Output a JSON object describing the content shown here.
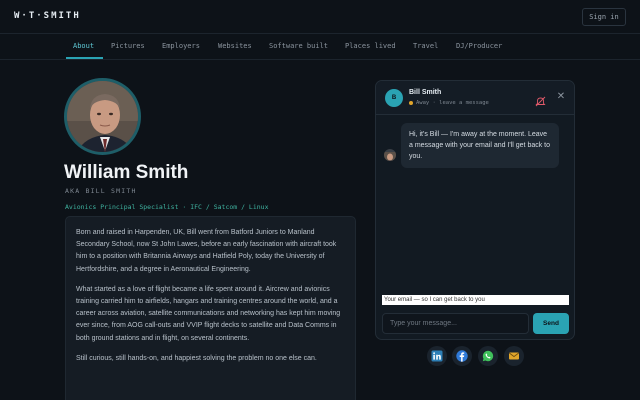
{
  "header": {
    "logo": "W·T·SMITH",
    "signin_label": "Sign in"
  },
  "nav": {
    "tabs": [
      {
        "label": "About",
        "active": true
      },
      {
        "label": "Pictures"
      },
      {
        "label": "Employers"
      },
      {
        "label": "Websites"
      },
      {
        "label": "Software built"
      },
      {
        "label": "Places lived"
      },
      {
        "label": "Travel"
      },
      {
        "label": "DJ/Producer"
      }
    ]
  },
  "profile": {
    "name": "William Smith",
    "aka": "AKA BILL SMITH",
    "role": "Avionics Principal Specialist · IFC / Satcom / Linux",
    "bio": [
      "Born and raised in Harpenden, UK, Bill went from Batford Juniors to Manland Secondary School, now St John Lawes, before an early fascination with aircraft took him to a position with Britannia Airways and Hatfield Poly, today the University of Hertfordshire, and a degree in Aeronautical Engineering.",
      "What started as a love of flight became a life spent around it. Aircrew and avionics training carried him to airfields, hangars and training centres around the world, and a career across aviation, satellite communications and networking has kept him moving ever since, from AOG call-outs and VVIP flight decks to satellite and Data Comms in both ground stations and in flight, on several continents.",
      "Still curious, still hands-on, and happiest solving the problem no one else can."
    ]
  },
  "chat": {
    "name": "Bill Smith",
    "avatar_initial": "B",
    "status": "Away · leave a message",
    "message": "Hi, it's Bill — I'm away at the moment. Leave a message with your email and I'll get back to you.",
    "email_placeholder": "Your email — so I can get back to you",
    "message_placeholder": "Type your message...",
    "send_label": "Send"
  },
  "social": {
    "icons": [
      "linkedin-icon",
      "facebook-icon",
      "whatsapp-icon",
      "email-icon"
    ]
  },
  "colors": {
    "background": "#0d1218",
    "accent": "#2aa3b3",
    "role_text": "#3fb3a0",
    "away_status": "#e0a52b"
  }
}
